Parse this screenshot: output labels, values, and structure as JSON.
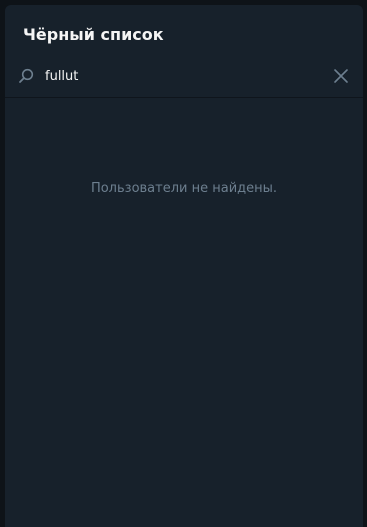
{
  "dialog": {
    "title": "Чёрный список"
  },
  "search": {
    "value": "fullut",
    "icon": "search-icon",
    "clear_icon": "close-icon"
  },
  "results": {
    "empty_message": "Пользователи не найдены."
  },
  "colors": {
    "background": "#17212b",
    "title_text": "#f5f5f5",
    "muted_text": "#6d7f8f",
    "icon": "#6d7f8f"
  }
}
